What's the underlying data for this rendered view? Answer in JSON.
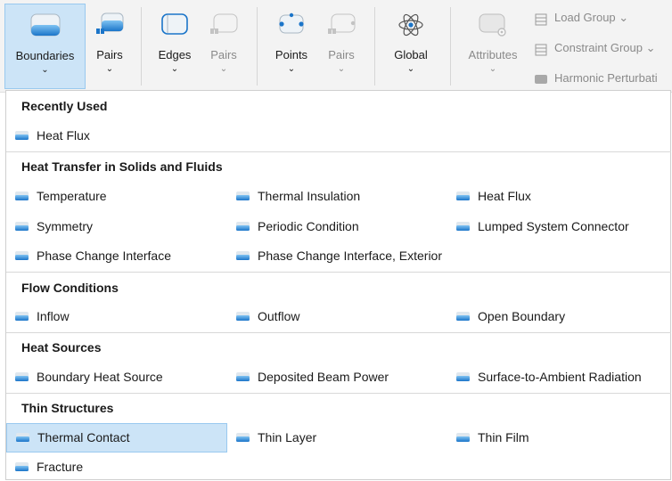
{
  "ribbon": {
    "buttons": [
      {
        "label": "Boundaries",
        "chevron": "⌄"
      },
      {
        "label": "Pairs",
        "chevron": "⌄"
      },
      {
        "label": "Edges",
        "chevron": "⌄"
      },
      {
        "label": "Pairs",
        "chevron": "⌄"
      },
      {
        "label": "Points",
        "chevron": "⌄"
      },
      {
        "label": "Pairs",
        "chevron": "⌄"
      },
      {
        "label": "Global",
        "chevron": "⌄"
      },
      {
        "label": "Attributes",
        "chevron": "⌄"
      }
    ],
    "small_items": [
      {
        "label": "Load Group ⌄"
      },
      {
        "label": "Constraint Group ⌄"
      },
      {
        "label": "Harmonic Perturbati"
      }
    ]
  },
  "menu": {
    "sections": [
      {
        "title": "Recently Used",
        "items": [
          "Heat Flux"
        ]
      },
      {
        "title": "Heat Transfer in Solids and Fluids",
        "items": [
          "Temperature",
          "Thermal Insulation",
          "Heat Flux",
          "Symmetry",
          "Periodic Condition",
          "Lumped System Connector",
          "Phase Change Interface",
          "Phase Change Interface, Exterior"
        ]
      },
      {
        "title": "Flow Conditions",
        "items": [
          "Inflow",
          "Outflow",
          "Open Boundary"
        ]
      },
      {
        "title": "Heat Sources",
        "items": [
          "Boundary Heat Source",
          "Deposited Beam Power",
          "Surface-to-Ambient Radiation"
        ]
      },
      {
        "title": "Thin Structures",
        "items": [
          "Thermal Contact",
          "Thin Layer",
          "Thin Film",
          "Fracture"
        ]
      }
    ]
  },
  "colors": {
    "accent": "#1e88e5",
    "highlight": "#cce4f7"
  }
}
